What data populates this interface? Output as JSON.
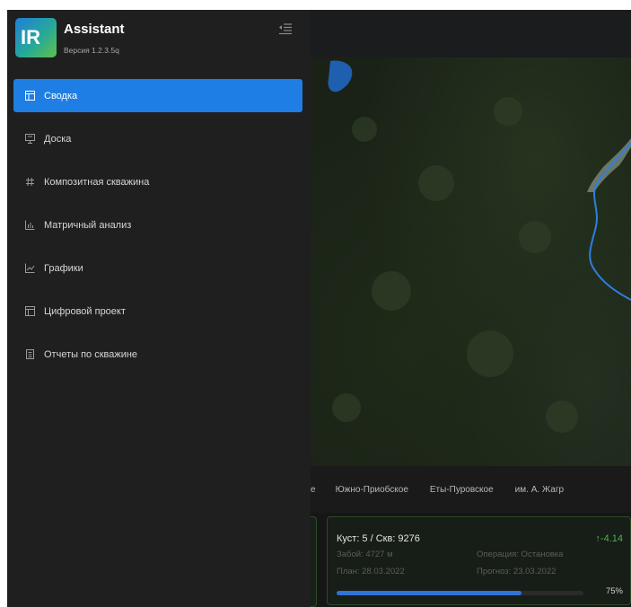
{
  "app": {
    "logo_text": "IR",
    "title": "Assistant",
    "version": "Версия 1.2.3.5q"
  },
  "colors": {
    "accent": "#1e7ee4",
    "sidebar_bg": "#1f1f1f",
    "positive": "#4caf50",
    "progress": "#2f73d4"
  },
  "sidebar": {
    "items": [
      {
        "label": "Сводка",
        "icon": "dashboard-icon",
        "active": true
      },
      {
        "label": "Доска",
        "icon": "monitor-icon",
        "active": false
      },
      {
        "label": "Композитная скважина",
        "icon": "hash-icon",
        "active": false
      },
      {
        "label": "Матричный анализ",
        "icon": "bar-chart-icon",
        "active": false
      },
      {
        "label": "Графики",
        "icon": "line-chart-icon",
        "active": false
      },
      {
        "label": "Цифровой проект",
        "icon": "layout-icon",
        "active": false
      },
      {
        "label": "Отчеты по скважине",
        "icon": "report-icon",
        "active": false
      }
    ]
  },
  "fields": {
    "partial": "е",
    "tabs": [
      "Южно-Приобское",
      "Еты-Пуровское",
      "им. А. Жагр"
    ]
  },
  "well_card": {
    "title": "Куст: 5 / Скв: 9276",
    "delta": "↑-4.14",
    "depth": "Забой: 4727 м",
    "operation": "Операция: Остановка",
    "plan": "План: 28.03.2022",
    "forecast": "Прогноз: 23.03.2022",
    "progress_percent": 75,
    "progress_label": "75%"
  }
}
